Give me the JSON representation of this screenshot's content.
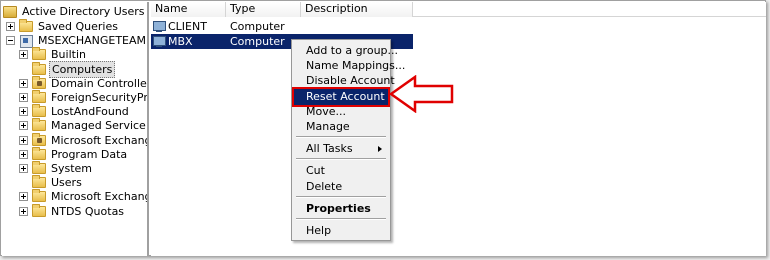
{
  "tree": {
    "root_label": "Active Directory Users and Comput",
    "items": [
      {
        "label": "Saved Queries",
        "expander": "plus",
        "depth": 1,
        "icon": "folder"
      },
      {
        "label": "MSEXCHANGETEAM.IN",
        "expander": "minus",
        "depth": 1,
        "icon": "domain"
      },
      {
        "label": "Builtin",
        "expander": "plus",
        "depth": 2,
        "icon": "folder"
      },
      {
        "label": "Computers",
        "expander": "none",
        "depth": 2,
        "icon": "folder",
        "selected": true
      },
      {
        "label": "Domain Controllers",
        "expander": "plus",
        "depth": 2,
        "icon": "folder-special"
      },
      {
        "label": "ForeignSecurityPrincipals",
        "expander": "plus",
        "depth": 2,
        "icon": "folder"
      },
      {
        "label": "LostAndFound",
        "expander": "plus",
        "depth": 2,
        "icon": "folder"
      },
      {
        "label": "Managed Service Accounts",
        "expander": "plus",
        "depth": 2,
        "icon": "folder"
      },
      {
        "label": "Microsoft Exchange Securit",
        "expander": "plus",
        "depth": 2,
        "icon": "folder-special"
      },
      {
        "label": "Program Data",
        "expander": "plus",
        "depth": 2,
        "icon": "folder"
      },
      {
        "label": "System",
        "expander": "plus",
        "depth": 2,
        "icon": "folder"
      },
      {
        "label": "Users",
        "expander": "none",
        "depth": 2,
        "icon": "folder"
      },
      {
        "label": "Microsoft Exchange System",
        "expander": "plus",
        "depth": 2,
        "icon": "folder"
      },
      {
        "label": "NTDS Quotas",
        "expander": "plus",
        "depth": 2,
        "icon": "folder"
      }
    ]
  },
  "list": {
    "columns": [
      "Name",
      "Type",
      "Description"
    ],
    "rows": [
      {
        "name": "CLIENT",
        "type": "Computer",
        "description": "",
        "selected": false
      },
      {
        "name": "MBX",
        "type": "Computer",
        "description": "",
        "selected": true
      }
    ]
  },
  "context_menu": {
    "items": [
      {
        "label": "Add to a group...",
        "kind": "item"
      },
      {
        "label": "Name Mappings...",
        "kind": "item"
      },
      {
        "label": "Disable Account",
        "kind": "item"
      },
      {
        "label": "Reset Account",
        "kind": "item",
        "highlighted": true
      },
      {
        "label": "Move...",
        "kind": "item"
      },
      {
        "label": "Manage",
        "kind": "item"
      },
      {
        "kind": "separator"
      },
      {
        "label": "All Tasks",
        "kind": "submenu"
      },
      {
        "kind": "separator"
      },
      {
        "label": "Cut",
        "kind": "item"
      },
      {
        "label": "Delete",
        "kind": "item"
      },
      {
        "kind": "separator"
      },
      {
        "label": "Properties",
        "kind": "item",
        "bold": true
      },
      {
        "kind": "separator"
      },
      {
        "label": "Help",
        "kind": "item"
      }
    ]
  },
  "colors": {
    "selection": "#0a246a",
    "callout_red": "#e00000",
    "folder_yellow": "#e8be4b"
  }
}
